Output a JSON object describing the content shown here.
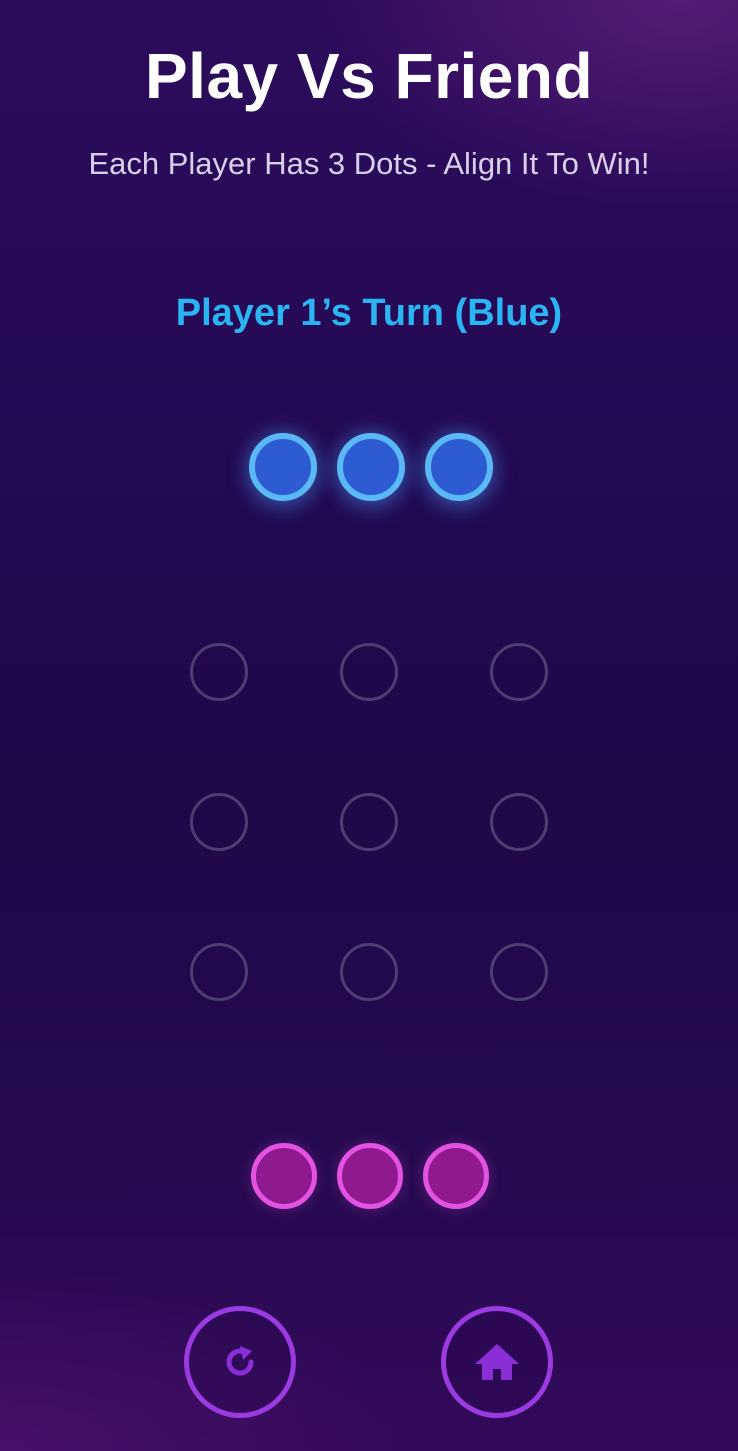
{
  "header": {
    "title": "Play Vs Friend",
    "subtitle": "Each Player Has 3 Dots - Align It To Win!"
  },
  "status": {
    "turn_text": "Player 1’s Turn (Blue)",
    "turn_color": "#2bb4f2"
  },
  "players": {
    "player1": {
      "color_name": "Blue",
      "fill": "#2d5bd2",
      "ring": "#5ab8f5",
      "pieces_remaining": 3
    },
    "player2": {
      "color_name": "Pink",
      "fill": "#8f1a8f",
      "ring": "#e352e0",
      "pieces_remaining": 3
    }
  },
  "board": {
    "rows": 3,
    "cols": 3,
    "cells": [
      [
        "empty",
        "empty",
        "empty"
      ],
      [
        "empty",
        "empty",
        "empty"
      ],
      [
        "empty",
        "empty",
        "empty"
      ]
    ],
    "cell_ring_color": "#4e3d70"
  },
  "controls": {
    "restart_icon": "restart-icon",
    "home_icon": "home-icon",
    "accent": "#9a3ae0"
  }
}
